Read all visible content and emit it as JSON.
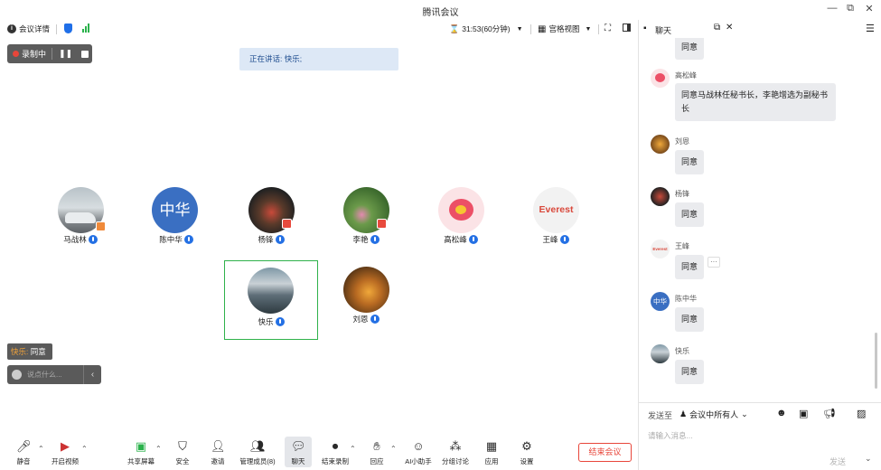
{
  "window": {
    "title": "腾讯会议",
    "minimize": "—",
    "restore": "⧉",
    "close": "✕"
  },
  "topbar": {
    "meeting_info": "会议详情",
    "timer": "31:53(60分钟)",
    "view_mode": "宫格视图"
  },
  "recording": {
    "label": "录制中"
  },
  "speaking_banner": "正在讲话: 快乐;",
  "participants": [
    {
      "name": "马战林",
      "avatar": "car-photo"
    },
    {
      "name": "陈中华",
      "avatar": "text-avatar",
      "avatar_text": "中华",
      "color": "#3a6fc2"
    },
    {
      "name": "杨锋",
      "avatar": "stage-photo"
    },
    {
      "name": "李艳",
      "avatar": "lotus-photo"
    },
    {
      "name": "高松峰",
      "avatar": "pig-cartoon"
    },
    {
      "name": "王峰",
      "avatar": "everest-logo",
      "avatar_text": "Everest"
    },
    {
      "name": "快乐",
      "avatar": "sky-photo",
      "active": true
    },
    {
      "name": "刘恩",
      "avatar": "food-photo"
    }
  ],
  "chat_popup": {
    "sender": "快乐:",
    "text": "同意"
  },
  "quick_input": {
    "placeholder": "说点什么..."
  },
  "toolbar": {
    "mute": "静音",
    "video": "开启视频",
    "share": "共享屏幕",
    "security": "安全",
    "invite": "邀请",
    "members": "管理成员(8)",
    "chat": "聊天",
    "stop_record": "结束录制",
    "react": "回应",
    "ai": "AI小助手",
    "breakout": "分组讨论",
    "apps": "应用",
    "settings": "设置",
    "end_meeting": "结束会议"
  },
  "chat": {
    "title": "聊天",
    "messages": [
      {
        "sender": "",
        "text": "同意"
      },
      {
        "sender": "高松峰",
        "text": "同意马战林任秘书长，李艳增选为副秘书长"
      },
      {
        "sender": "刘恩",
        "text": "同意"
      },
      {
        "sender": "杨锋",
        "text": "同意"
      },
      {
        "sender": "王峰",
        "text": "同意"
      },
      {
        "sender": "陈中华",
        "text": "同意"
      },
      {
        "sender": "快乐",
        "text": "同意"
      }
    ],
    "send_to_label": "发送至",
    "send_to_target": "会议中所有人",
    "input_placeholder": "请输入消息...",
    "send_button": "发送",
    "more": "···"
  },
  "colors": {
    "accent": "#2470e4",
    "recording": "#e8463a",
    "active_border": "#2fb24b",
    "bubble": "#eaebee"
  }
}
